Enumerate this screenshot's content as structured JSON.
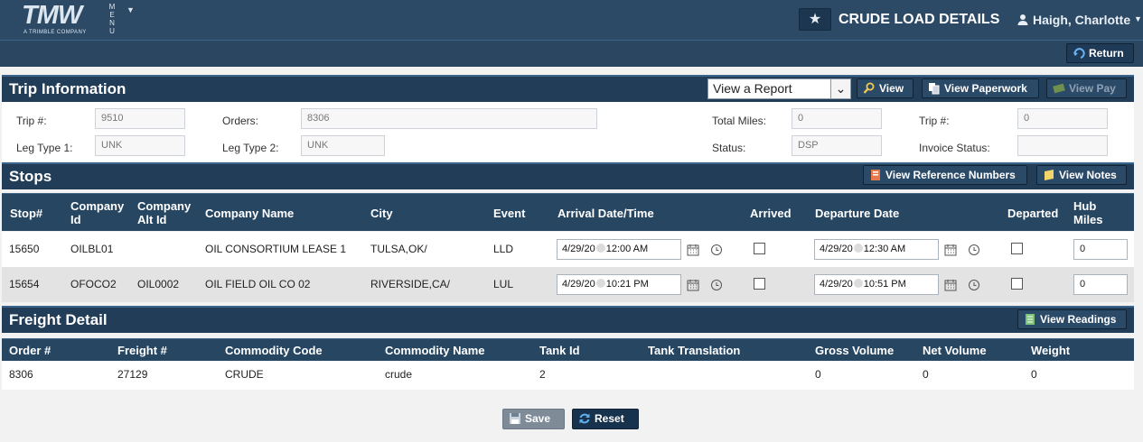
{
  "header": {
    "logo": "TMW",
    "logo_sub": "A TRIMBLE COMPANY",
    "menu_label": "MENU",
    "title": "CRUDE LOAD DETAILS",
    "user": "Haigh, Charlotte"
  },
  "toolbar": {
    "return_label": "Return"
  },
  "trip_info": {
    "title": "Trip Information",
    "report_select": "View a Report",
    "view_label": "View",
    "view_paperwork_label": "View Paperwork",
    "view_pay_label": "View Pay",
    "fields": {
      "trip_label": "Trip #:",
      "trip_value": "9510",
      "orders_label": "Orders:",
      "orders_value": "8306",
      "total_miles_label": "Total Miles:",
      "total_miles_value": "0",
      "trip2_label": "Trip #:",
      "trip2_value": "0",
      "leg1_label": "Leg Type 1:",
      "leg1_value": "UNK",
      "leg2_label": "Leg Type 2:",
      "leg2_value": "UNK",
      "status_label": "Status:",
      "status_value": "DSP",
      "invoice_label": "Invoice Status:",
      "invoice_value": ""
    }
  },
  "stops": {
    "title": "Stops",
    "ref_numbers_label": "View Reference Numbers",
    "notes_label": "View Notes",
    "columns": {
      "stop": "Stop#",
      "company_id_1": "Company",
      "company_id_2": "Id",
      "alt_1": "Company",
      "alt_2": "Alt Id",
      "name": "Company Name",
      "city": "City",
      "event": "Event",
      "arrival": "Arrival Date/Time",
      "arrived": "Arrived",
      "departure": "Departure Date",
      "departed": "Departed",
      "hub_1": "Hub",
      "hub_2": "Miles"
    },
    "rows": [
      {
        "stop": "15650",
        "company_id": "OILBL01",
        "alt_id": "",
        "name": "OIL CONSORTIUM LEASE 1",
        "city": "TULSA,OK/",
        "event": "LLD",
        "arr_date": "4/29/20",
        "arr_time": "12:00 AM",
        "dep_date": "4/29/20",
        "dep_time": "12:30 AM",
        "hub": "0"
      },
      {
        "stop": "15654",
        "company_id": "OFOCO2",
        "alt_id": "OIL0002",
        "name": "OIL FIELD OIL CO 02",
        "city": "RIVERSIDE,CA/",
        "event": "LUL",
        "arr_date": "4/29/20",
        "arr_time": "10:21 PM",
        "dep_date": "4/29/20",
        "dep_time": "10:51 PM",
        "hub": "0"
      }
    ]
  },
  "freight": {
    "title": "Freight Detail",
    "readings_label": "View Readings",
    "columns": {
      "order": "Order #",
      "freight": "Freight #",
      "commodity_code": "Commodity Code",
      "commodity_name": "Commodity Name",
      "tank_id": "Tank Id",
      "tank_translation": "Tank Translation",
      "gross": "Gross Volume",
      "net": "Net Volume",
      "weight": "Weight"
    },
    "row": {
      "order": "8306",
      "freight": "27129",
      "commodity_code": "CRUDE",
      "commodity_name": "crude",
      "tank_id": "2",
      "tank_translation": "",
      "gross": "0",
      "net": "0",
      "weight": "0"
    }
  },
  "footer": {
    "save_label": "Save",
    "reset_label": "Reset"
  },
  "colors": {
    "header_bg": "#2c4a66",
    "section_bg": "#223d58",
    "alt_row": "#e3e3e3"
  }
}
